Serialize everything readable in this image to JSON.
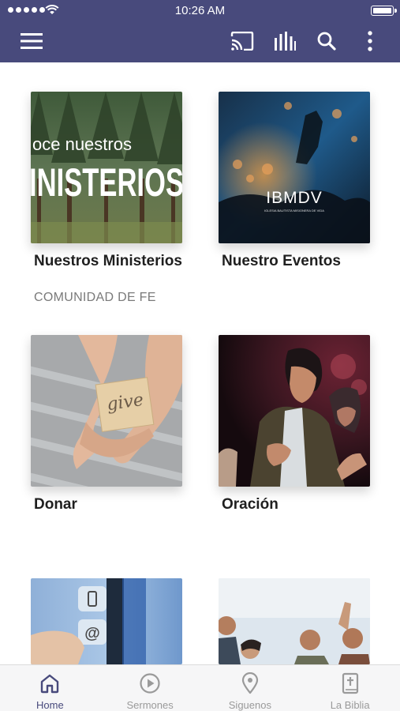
{
  "status_bar": {
    "time": "10:26 AM"
  },
  "app_bar": {
    "actions": [
      "menu-icon",
      "cast-icon",
      "equalizer-icon",
      "search-icon",
      "more-vert-icon"
    ]
  },
  "tiles": [
    {
      "title": "Nuestros Ministerios",
      "subtitle": "COMUNIDAD DE FE",
      "image_text": [
        "oce nuestros",
        "INISTERIOS"
      ]
    },
    {
      "title": "Nuestro Eventos",
      "image_text": [
        "IBMDV",
        "IGLESIA BAUTISTA MISIONERA DE VIDA"
      ]
    },
    {
      "title": "Donar",
      "image_text": [
        "give"
      ]
    },
    {
      "title": "Oración"
    }
  ],
  "bottom_nav": [
    {
      "label": "Home",
      "icon": "home-icon",
      "active": true
    },
    {
      "label": "Sermones",
      "icon": "play-circle-icon",
      "active": false
    },
    {
      "label": "Siguenos",
      "icon": "location-pin-icon",
      "active": false
    },
    {
      "label": "La Biblia",
      "icon": "bible-icon",
      "active": false
    }
  ],
  "colors": {
    "brand": "#484a7c",
    "nav_inactive": "#9a9a9a",
    "text_dark": "#1f1f1f"
  }
}
